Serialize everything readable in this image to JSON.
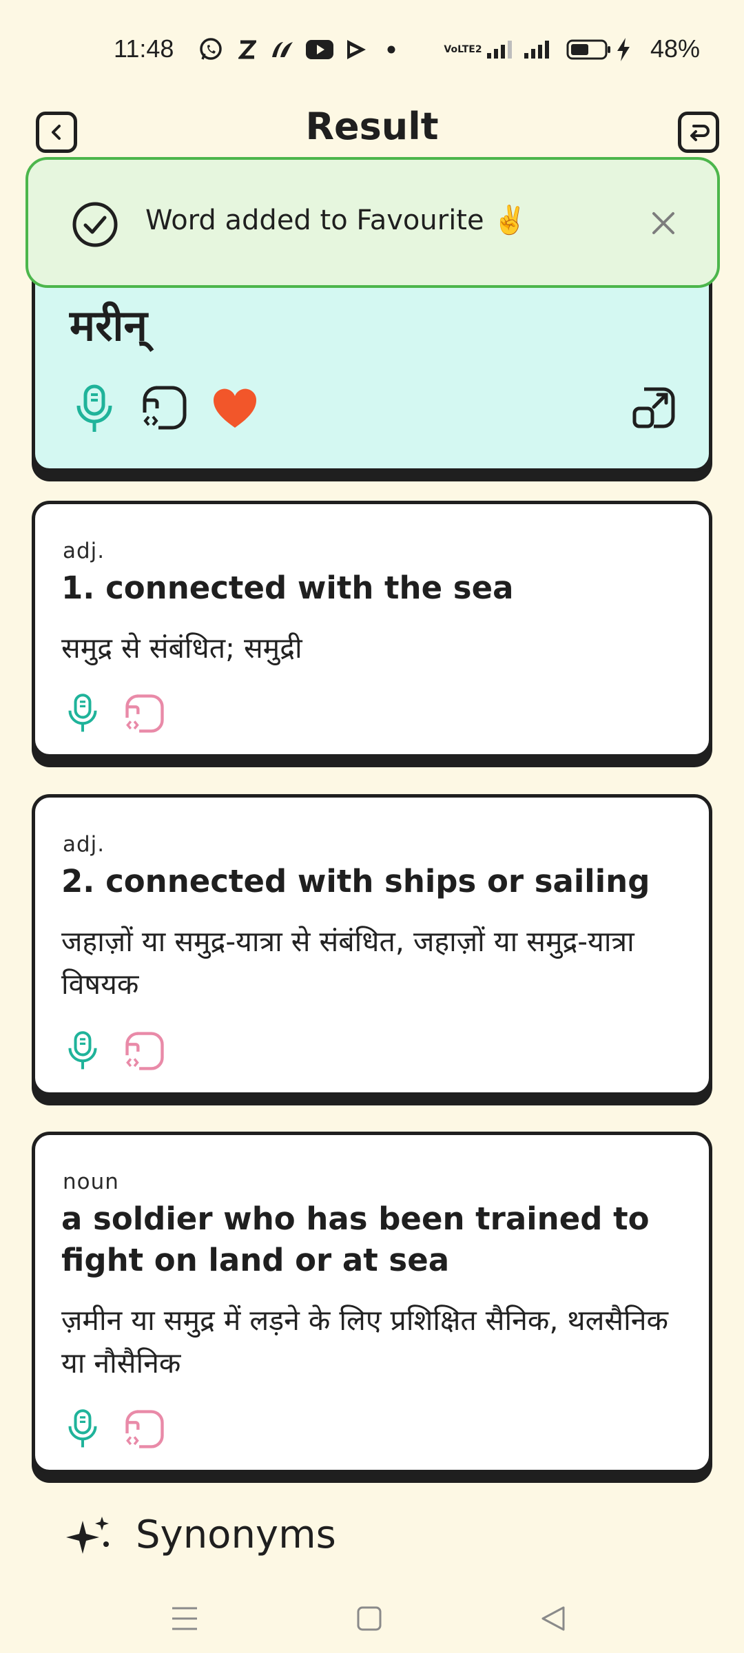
{
  "status_bar": {
    "time": "11:48",
    "network_label": "VoLTE2",
    "battery_percent": "48%",
    "icons": [
      "whatsapp-icon",
      "zomato-icon",
      "app-icon",
      "youtube-icon",
      "play-icon",
      "dot-icon",
      "signal-icon",
      "signal-icon",
      "battery-icon",
      "charging-icon"
    ]
  },
  "header": {
    "title": "Result",
    "back_icon": "chevron-left-icon",
    "action_icon": "undo-icon"
  },
  "toast": {
    "message": "Word added to Favourite ✌️",
    "check_icon": "check-circle-icon",
    "close_icon": "close-icon"
  },
  "word_card": {
    "word": "मरीन्",
    "actions": [
      "microphone-icon",
      "translate-icon",
      "heart-icon",
      "share-icon"
    ]
  },
  "definitions": [
    {
      "pos": "adj.",
      "meaning": "1. connected with the sea",
      "hindi": "समुद्र से संबंधित; समुद्री"
    },
    {
      "pos": "adj.",
      "meaning": "2. connected with ships or sailing",
      "hindi": "जहाज़ों या समुद्र-यात्रा से संबंधित, जहाज़ों या समुद्र-यात्रा विषयक"
    },
    {
      "pos": "noun",
      "meaning": "a soldier who has been trained to fight on land or at sea",
      "hindi": "ज़मीन या समुद्र में लड़ने के लिए प्रशिक्षित सैनिक, थलसैनिक या नौसैनिक"
    }
  ],
  "synonyms": {
    "label": "Synonyms",
    "icon": "sparkle-icon"
  },
  "nav": {
    "icons": [
      "menu-icon",
      "home-square-icon",
      "back-triangle-icon"
    ]
  },
  "colors": {
    "background": "#fdf8e4",
    "word_card": "#d4f8f2",
    "toast_bg": "#e6f6de",
    "toast_border": "#4cb64c",
    "mic": "#1fb39a",
    "translate_pink": "#e98aa8",
    "heart": "#f2562a"
  }
}
